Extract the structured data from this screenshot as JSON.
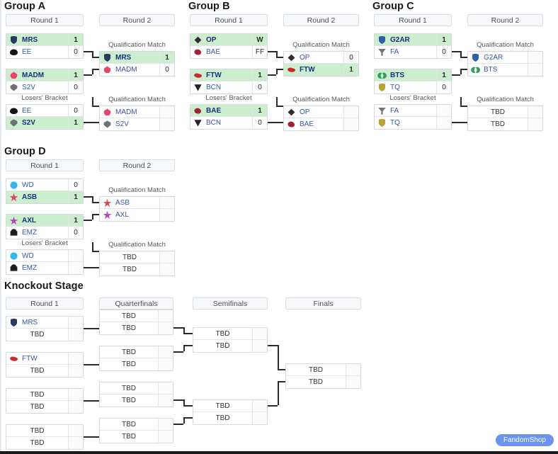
{
  "page": {
    "fandom_shop_label": "FandomShop"
  },
  "sections": [
    {
      "title": "Group A",
      "rounds": [
        "Round 1",
        "Round 2"
      ],
      "matches": [
        {
          "caption": "",
          "rows": [
            {
              "logo": "shield-navy-icon",
              "team": "MRS",
              "score": "1",
              "winner": true
            },
            {
              "logo": "oval-black-icon",
              "team": "EE",
              "score": "0",
              "winner": false
            }
          ]
        },
        {
          "caption": "",
          "rows": [
            {
              "logo": "flower-pink-icon",
              "team": "MADM",
              "score": "1",
              "winner": true
            },
            {
              "logo": "crest-grey-icon",
              "team": "S2V",
              "score": "0",
              "winner": false
            }
          ]
        },
        {
          "caption": "Losers' Bracket",
          "rows": [
            {
              "logo": "oval-black-icon",
              "team": "EE",
              "score": "0",
              "winner": false
            },
            {
              "logo": "crest-grey-icon",
              "team": "S2V",
              "score": "1",
              "winner": true
            }
          ]
        },
        {
          "caption": "Qualification Match",
          "rows": [
            {
              "logo": "shield-navy-icon",
              "team": "MRS",
              "score": "1",
              "winner": true
            },
            {
              "logo": "flower-pink-icon",
              "team": "MADM",
              "score": "0",
              "winner": false
            }
          ]
        },
        {
          "caption": "Qualification Match",
          "rows": [
            {
              "logo": "flower-pink-icon",
              "team": "MADM",
              "score": "",
              "winner": false
            },
            {
              "logo": "crest-grey-icon",
              "team": "S2V",
              "score": "",
              "winner": false
            }
          ]
        }
      ]
    },
    {
      "title": "Group B",
      "rounds": [
        "Round 1",
        "Round 2"
      ],
      "matches": [
        {
          "caption": "",
          "rows": [
            {
              "logo": "diamond-outline-icon",
              "team": "OP",
              "score": "W",
              "winner": true
            },
            {
              "logo": "boot-red-icon",
              "team": "BAE",
              "score": "FF",
              "winner": false
            }
          ]
        },
        {
          "caption": "",
          "rows": [
            {
              "logo": "bull-red-icon",
              "team": "FTW",
              "score": "1",
              "winner": true
            },
            {
              "logo": "vee-black-icon",
              "team": "BCN",
              "score": "0",
              "winner": false
            }
          ]
        },
        {
          "caption": "Losers' Bracket",
          "rows": [
            {
              "logo": "boot-red-icon",
              "team": "BAE",
              "score": "1",
              "winner": true
            },
            {
              "logo": "vee-black-icon",
              "team": "BCN",
              "score": "0",
              "winner": false
            }
          ]
        },
        {
          "caption": "Qualification Match",
          "rows": [
            {
              "logo": "diamond-outline-icon",
              "team": "OP",
              "score": "0",
              "winner": false
            },
            {
              "logo": "bull-red-icon",
              "team": "FTW",
              "score": "1",
              "winner": true
            }
          ]
        },
        {
          "caption": "Qualification Match",
          "rows": [
            {
              "logo": "diamond-outline-icon",
              "team": "OP",
              "score": "",
              "winner": false
            },
            {
              "logo": "boot-red-icon",
              "team": "BAE",
              "score": "",
              "winner": false
            }
          ]
        }
      ]
    },
    {
      "title": "Group C",
      "rounds": [
        "Round 1",
        "Round 2"
      ],
      "matches": [
        {
          "caption": "",
          "rows": [
            {
              "logo": "shield-blue-icon",
              "team": "G2AR",
              "score": "1",
              "winner": true
            },
            {
              "logo": "wye-grey-icon",
              "team": "FA",
              "score": "0",
              "winner": false
            }
          ]
        },
        {
          "caption": "",
          "rows": [
            {
              "logo": "rings-green-icon",
              "team": "BTS",
              "score": "1",
              "winner": true
            },
            {
              "logo": "shield-gold-icon",
              "team": "TQ",
              "score": "0",
              "winner": false
            }
          ]
        },
        {
          "caption": "Losers' Bracket",
          "rows": [
            {
              "logo": "wye-grey-icon",
              "team": "FA",
              "score": "",
              "winner": false
            },
            {
              "logo": "shield-gold-icon",
              "team": "TQ",
              "score": "",
              "winner": false
            }
          ]
        },
        {
          "caption": "Qualification Match",
          "rows": [
            {
              "logo": "shield-blue-icon",
              "team": "G2AR",
              "score": "",
              "winner": false
            },
            {
              "logo": "rings-green-icon",
              "team": "BTS",
              "score": "",
              "winner": false
            }
          ]
        },
        {
          "caption": "Qualification Match",
          "rows": [
            {
              "logo": "",
              "team": "TBD",
              "score": "",
              "winner": false
            },
            {
              "logo": "",
              "team": "TBD",
              "score": "",
              "winner": false
            }
          ]
        }
      ]
    },
    {
      "title": "Group D",
      "rounds": [
        "Round 1",
        "Round 2"
      ],
      "matches": [
        {
          "caption": "",
          "rows": [
            {
              "logo": "orb-cyan-icon",
              "team": "WD",
              "score": "0",
              "winner": false
            },
            {
              "logo": "star-red-icon",
              "team": "ASB",
              "score": "1",
              "winner": true
            }
          ]
        },
        {
          "caption": "",
          "rows": [
            {
              "logo": "star-purple-icon",
              "team": "AXL",
              "score": "1",
              "winner": true
            },
            {
              "logo": "crown-black-icon",
              "team": "EMZ",
              "score": "0",
              "winner": false
            }
          ]
        },
        {
          "caption": "Losers' Bracket",
          "rows": [
            {
              "logo": "orb-cyan-icon",
              "team": "WD",
              "score": "",
              "winner": false
            },
            {
              "logo": "crown-black-icon",
              "team": "EMZ",
              "score": "",
              "winner": false
            }
          ]
        },
        {
          "caption": "Qualification Match",
          "rows": [
            {
              "logo": "star-red-icon",
              "team": "ASB",
              "score": "",
              "winner": false
            },
            {
              "logo": "star-purple-icon",
              "team": "AXL",
              "score": "",
              "winner": false
            }
          ]
        },
        {
          "caption": "Qualification Match",
          "rows": [
            {
              "logo": "",
              "team": "TBD",
              "score": "",
              "winner": false
            },
            {
              "logo": "",
              "team": "TBD",
              "score": "",
              "winner": false
            }
          ]
        }
      ]
    }
  ],
  "knockout": {
    "title": "Knockout Stage",
    "rounds": [
      "Round 1",
      "Quarterfinals",
      "Semifinals",
      "Finals"
    ],
    "round1": [
      {
        "rows": [
          {
            "logo": "shield-navy-icon",
            "team": "MRS",
            "score": "",
            "centered": false
          },
          {
            "logo": "",
            "team": "TBD",
            "score": "",
            "centered": true
          }
        ]
      },
      {
        "rows": [
          {
            "logo": "bull-red-icon",
            "team": "FTW",
            "score": "",
            "centered": false
          },
          {
            "logo": "",
            "team": "TBD",
            "score": "",
            "centered": true
          }
        ]
      },
      {
        "rows": [
          {
            "logo": "",
            "team": "TBD",
            "score": "",
            "centered": true
          },
          {
            "logo": "",
            "team": "TBD",
            "score": "",
            "centered": true
          }
        ]
      },
      {
        "rows": [
          {
            "logo": "",
            "team": "TBD",
            "score": "",
            "centered": true
          },
          {
            "logo": "",
            "team": "TBD",
            "score": "",
            "centered": true
          }
        ]
      }
    ],
    "quarterfinals": [
      {
        "rows": [
          {
            "team": "TBD",
            "score": ""
          },
          {
            "team": "TBD",
            "score": ""
          }
        ]
      },
      {
        "rows": [
          {
            "team": "TBD",
            "score": ""
          },
          {
            "team": "TBD",
            "score": ""
          }
        ]
      },
      {
        "rows": [
          {
            "team": "TBD",
            "score": ""
          },
          {
            "team": "TBD",
            "score": ""
          }
        ]
      },
      {
        "rows": [
          {
            "team": "TBD",
            "score": ""
          },
          {
            "team": "TBD",
            "score": ""
          }
        ]
      }
    ],
    "semifinals": [
      {
        "rows": [
          {
            "team": "TBD",
            "score": ""
          },
          {
            "team": "TBD",
            "score": ""
          }
        ]
      },
      {
        "rows": [
          {
            "team": "TBD",
            "score": ""
          },
          {
            "team": "TBD",
            "score": ""
          }
        ]
      }
    ],
    "finals": [
      {
        "rows": [
          {
            "team": "TBD",
            "score": ""
          },
          {
            "team": "TBD",
            "score": ""
          }
        ]
      }
    ]
  }
}
